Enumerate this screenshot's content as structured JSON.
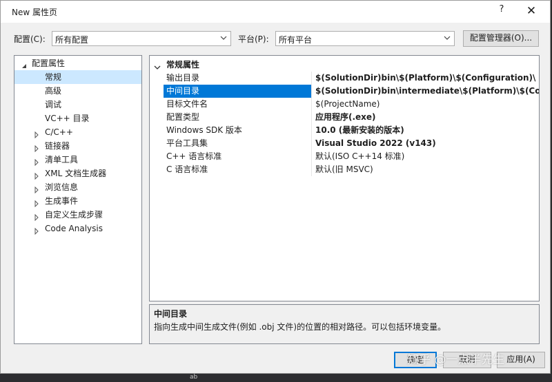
{
  "window": {
    "title": "New 属性页",
    "help": "?",
    "close": "✕"
  },
  "config_bar": {
    "config_label": "配置(C):",
    "config_value": "所有配置",
    "platform_label": "平台(P):",
    "platform_value": "所有平台",
    "manager_button": "配置管理器(O)..."
  },
  "tree": {
    "root": "配置属性",
    "children": [
      "常规",
      "高级",
      "调试",
      "VC++ 目录"
    ],
    "collapsed": [
      "C/C++",
      "链接器",
      "清单工具",
      "XML 文档生成器",
      "浏览信息",
      "生成事件",
      "自定义生成步骤",
      "Code Analysis"
    ]
  },
  "grid": {
    "header": "常规属性",
    "rows": [
      {
        "name": "输出目录",
        "value": "$(SolutionDir)bin\\$(Platform)\\$(Configuration)\\"
      },
      {
        "name": "中间目录",
        "value": "$(SolutionDir)bin\\intermediate\\$(Platform)\\$(Con"
      },
      {
        "name": "目标文件名",
        "value": "$(ProjectName)"
      },
      {
        "name": "配置类型",
        "value": "应用程序(.exe)"
      },
      {
        "name": "Windows SDK 版本",
        "value": "10.0 (最新安装的版本)"
      },
      {
        "name": "平台工具集",
        "value": "Visual Studio 2022 (v143)"
      },
      {
        "name": "C++ 语言标准",
        "value": "默认(ISO C++14 标准)"
      },
      {
        "name": "C 语言标准",
        "value": "默认(旧 MSVC)"
      }
    ]
  },
  "description": {
    "title": "中间目录",
    "text": "指向生成中间生成文件(例如 .obj 文件)的位置的相对路径。可以包括环境变量。"
  },
  "buttons": {
    "ok": "确定",
    "cancel": "取消",
    "apply": "应用(A)"
  },
  "taskbar": {
    "ab": "ab"
  },
  "watermark": "知乎 @一点半先生",
  "colors": {
    "selection": "#0078d7",
    "tree_selection": "#cce8ff"
  }
}
